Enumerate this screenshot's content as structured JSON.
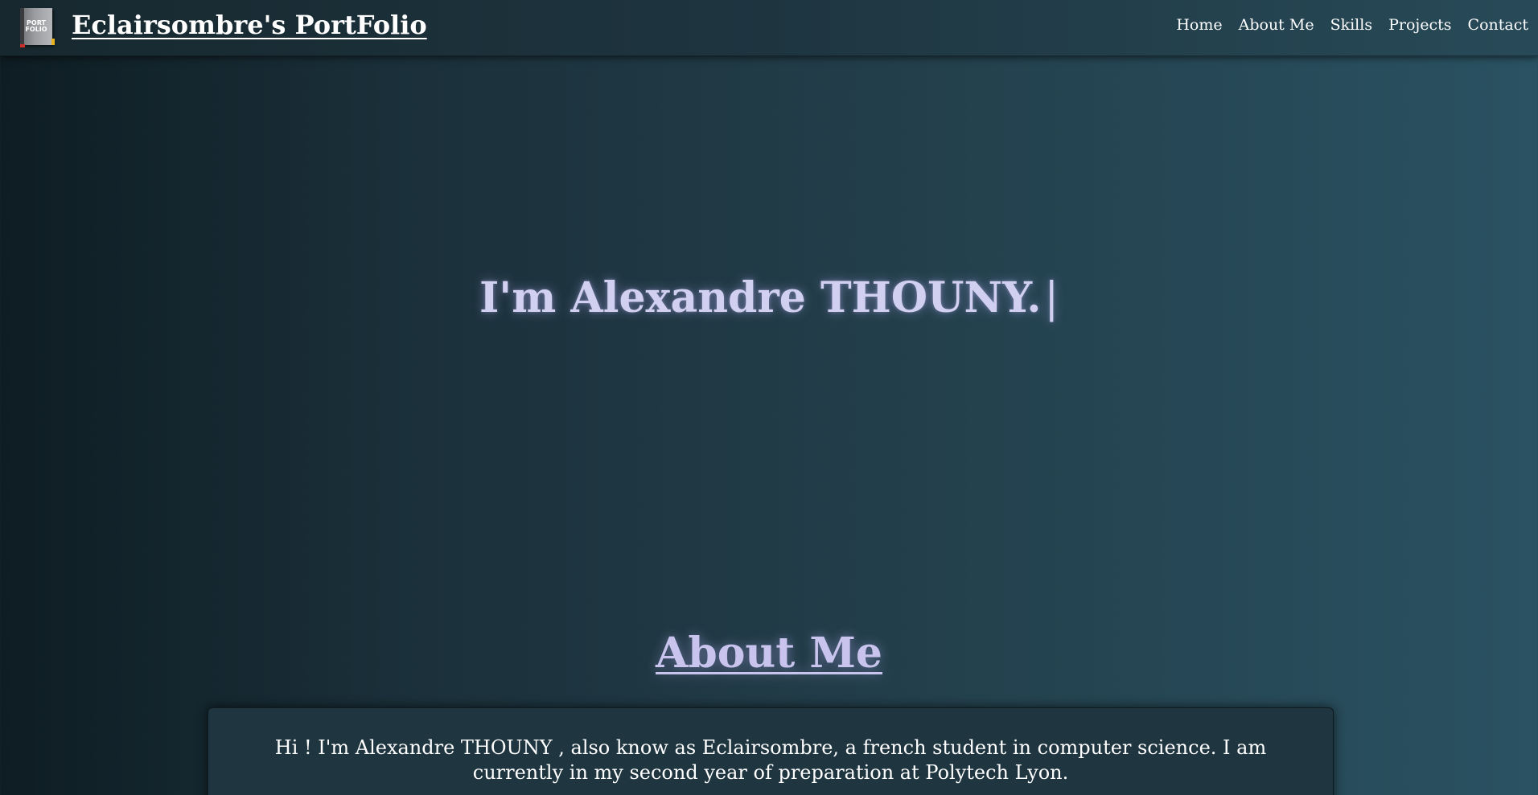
{
  "header": {
    "logo_icon": "portfolio-book-icon",
    "logo_text_line1": "PORT",
    "logo_text_line2": "FOLIO",
    "site_title": "Eclairsombre's PortFolio",
    "nav": [
      {
        "label": "Home"
      },
      {
        "label": "About Me"
      },
      {
        "label": "Skills"
      },
      {
        "label": "Projects"
      },
      {
        "label": "Contact"
      }
    ]
  },
  "hero": {
    "typed_text": "I'm Alexandre THOUNY.",
    "cursor": "|"
  },
  "about": {
    "heading": "About Me",
    "body": "Hi ! I'm Alexandre THOUNY , also know as Eclairsombre, a french student in computer science. I am currently in my second year of preparation at Polytech Lyon."
  },
  "colors": {
    "hero_text": "#d2d0f0",
    "background_start": "#0e1d23",
    "background_end": "#2a5262"
  }
}
